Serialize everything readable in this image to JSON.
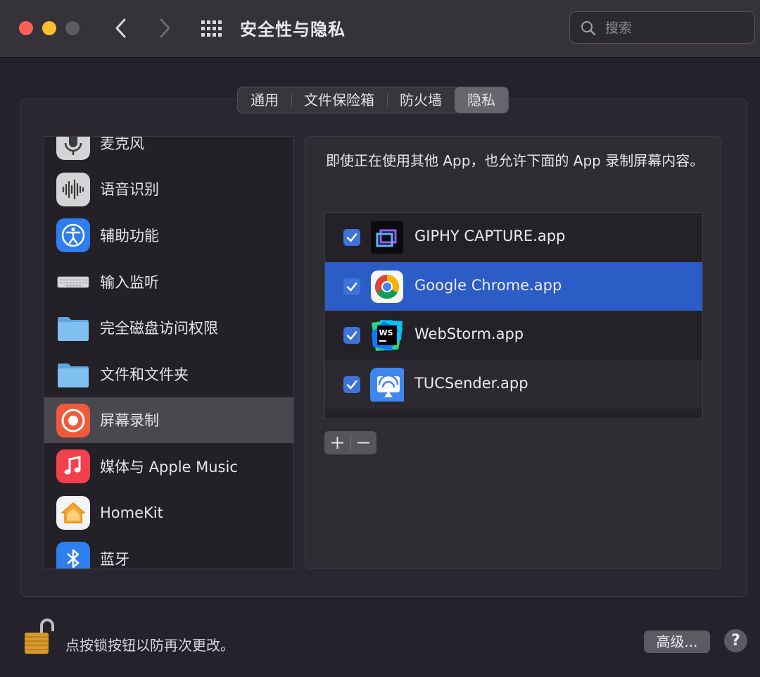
{
  "window": {
    "title": "安全性与隐私",
    "search_placeholder": "搜索"
  },
  "tabs": [
    {
      "label": "通用",
      "active": false
    },
    {
      "label": "文件保险箱",
      "active": false
    },
    {
      "label": "防火墙",
      "active": false
    },
    {
      "label": "隐私",
      "active": true
    }
  ],
  "sidebar": {
    "items": [
      {
        "label": "麦克风",
        "icon": "microphone-icon"
      },
      {
        "label": "语音识别",
        "icon": "speech-recognition-icon"
      },
      {
        "label": "辅助功能",
        "icon": "accessibility-icon"
      },
      {
        "label": "输入监听",
        "icon": "keyboard-icon"
      },
      {
        "label": "完全磁盘访问权限",
        "icon": "folder-icon"
      },
      {
        "label": "文件和文件夹",
        "icon": "folder-icon"
      },
      {
        "label": "屏幕录制",
        "icon": "screen-recording-icon",
        "selected": true
      },
      {
        "label": "媒体与 Apple Music",
        "icon": "music-icon"
      },
      {
        "label": "HomeKit",
        "icon": "homekit-icon"
      },
      {
        "label": "蓝牙",
        "icon": "bluetooth-icon"
      }
    ]
  },
  "main": {
    "description": "即使正在使用其他 App，也允许下面的 App 录制屏幕内容。",
    "apps": [
      {
        "name": "GIPHY CAPTURE.app",
        "checked": true
      },
      {
        "name": "Google Chrome.app",
        "checked": true,
        "selected": true
      },
      {
        "name": "WebStorm.app",
        "checked": true
      },
      {
        "name": "TUCSender.app",
        "checked": true
      }
    ],
    "add_label": "+",
    "remove_label": "−"
  },
  "footer": {
    "lock_text": "点按锁按钮以防再次更改。",
    "advanced_label": "高级...",
    "help_label": "?"
  },
  "colors": {
    "accent": "#2c5cc5",
    "checkbox": "#3d73d9"
  }
}
